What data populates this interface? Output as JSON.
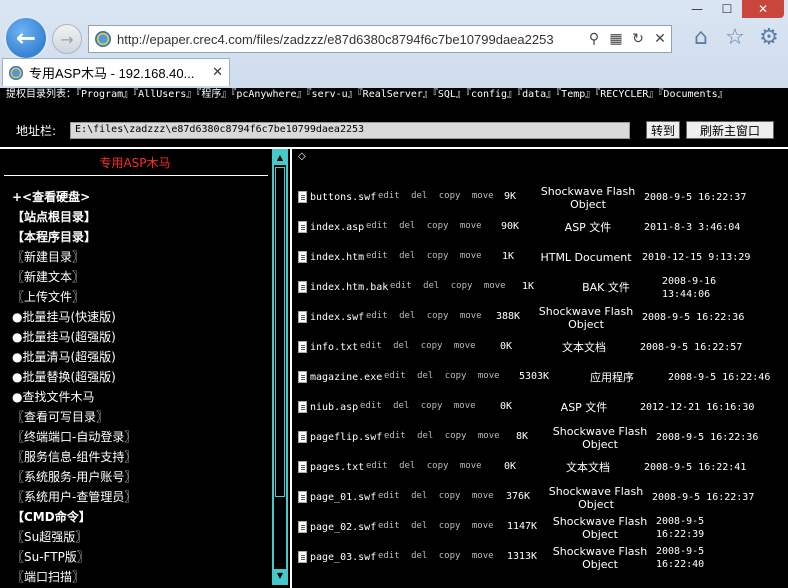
{
  "browser": {
    "window_buttons": {
      "minimize": "—",
      "maximize": "☐",
      "close": "✕"
    },
    "address_url": "http://epaper.crec4.com/files/zadzzz/e87d6380c8794f6c7be10799daea2253",
    "tab_title": "专用ASP木马 - 192.168.40...",
    "icons": [
      "back-icon",
      "forward-icon",
      "search-icon",
      "compat-icon",
      "refresh-icon",
      "stop-icon",
      "home-icon",
      "favorites-icon",
      "settings-icon"
    ]
  },
  "page": {
    "perm_label": "提权目录列表：",
    "perm_links": [
      "『Program』",
      "『AllUsers』",
      "『程序』",
      "『pcAnywhere』",
      "『serv-u』",
      "『RealServer』",
      "『SQL』",
      "『config』",
      "『data』",
      "『Temp』",
      "『RECYCLER』",
      "『Documents』"
    ],
    "addr_label": "地址栏:",
    "path_value": "E:\\files\\zadzzz\\e87d6380c8794f6c7be10799daea2253",
    "goto_label": "转到",
    "refresh_label": "刷新主窗口",
    "shell_title": "专用ASP木马",
    "right_anchor": "◇",
    "menu": [
      {
        "label": "+<查看硬盘>",
        "bold": true
      },
      {
        "label": "【站点根目录】",
        "bold": true
      },
      {
        "label": "【本程序目录】",
        "bold": true
      },
      {
        "label": "〖新建目录〗",
        "bold": false
      },
      {
        "label": "〖新建文本〗",
        "bold": false
      },
      {
        "label": "〖上传文件〗",
        "bold": false
      },
      {
        "label": "●批量挂马(快速版)",
        "bold": false
      },
      {
        "label": "●批量挂马(超强版)",
        "bold": false
      },
      {
        "label": "●批量清马(超强版)",
        "bold": false
      },
      {
        "label": "●批量替换(超强版)",
        "bold": false
      },
      {
        "label": "●查找文件木马",
        "bold": false
      },
      {
        "label": "〖查看可写目录〗",
        "bold": false
      },
      {
        "label": "〖终端端口-自动登录〗",
        "bold": false
      },
      {
        "label": "〖服务信息-组件支持〗",
        "bold": false
      },
      {
        "label": "〖系统服务-用户账号〗",
        "bold": false
      },
      {
        "label": "〖系统用户-查管理员〗",
        "bold": false
      },
      {
        "label": "【CMD命令】",
        "bold": true
      },
      {
        "label": "〖Su超强版〗",
        "bold": false
      },
      {
        "label": "〖Su-FTP版〗",
        "bold": false
      },
      {
        "label": "〖端口扫描〗",
        "bold": false
      }
    ],
    "files": [
      {
        "name": "buttons.swf",
        "actions": "edit del copy move",
        "size": "9K",
        "type": [
          "Shockwave Flash",
          "Object"
        ],
        "time": [
          "2008-9-5 16:22:37"
        ]
      },
      {
        "name": "index.asp",
        "actions": "edit del copy move",
        "size": "90K",
        "type": [
          "ASP 文件"
        ],
        "time": [
          "2011-8-3 3:46:04"
        ]
      },
      {
        "name": "index.htm",
        "actions": "edit del copy move",
        "size": "1K",
        "type": [
          "HTML Document"
        ],
        "time": [
          "2010-12-15 9:13:29"
        ]
      },
      {
        "name": "index.htm.bak",
        "actions": "edit del copy move",
        "size": "1K",
        "type": [
          "BAK 文件"
        ],
        "time": [
          "2008-9-16",
          "13:44:06"
        ]
      },
      {
        "name": "index.swf",
        "actions": "edit del copy move",
        "size": "388K",
        "type": [
          "Shockwave Flash",
          "Object"
        ],
        "time": [
          "2008-9-5 16:22:36"
        ]
      },
      {
        "name": "info.txt",
        "actions": "edit del copy move",
        "size": "0K",
        "type": [
          "文本文档"
        ],
        "time": [
          "2008-9-5 16:22:57"
        ]
      },
      {
        "name": "magazine.exe",
        "actions": "edit del copy move",
        "size": "5303K",
        "type": [
          "应用程序"
        ],
        "time": [
          "2008-9-5 16:22:46"
        ]
      },
      {
        "name": "niub.asp",
        "actions": "edit del copy move",
        "size": "0K",
        "type": [
          "ASP 文件"
        ],
        "time": [
          "2012-12-21 16:16:30"
        ]
      },
      {
        "name": "pageflip.swf",
        "actions": "edit del copy move",
        "size": "8K",
        "type": [
          "Shockwave Flash",
          "Object"
        ],
        "time": [
          "2008-9-5 16:22:36"
        ]
      },
      {
        "name": "pages.txt",
        "actions": "edit del copy move",
        "size": "0K",
        "type": [
          "文本文档"
        ],
        "time": [
          "2008-9-5 16:22:41"
        ]
      },
      {
        "name": "page_01.swf",
        "actions": "edit del copy move",
        "size": "376K",
        "type": [
          "Shockwave Flash",
          "Object"
        ],
        "time": [
          "2008-9-5 16:22:37"
        ]
      },
      {
        "name": "page_02.swf",
        "actions": "edit del copy move",
        "size": "1147K",
        "type": [
          "Shockwave Flash",
          "Object"
        ],
        "time": [
          "2008-9-5",
          "16:22:39"
        ]
      },
      {
        "name": "page_03.swf",
        "actions": "edit del copy move",
        "size": "1313K",
        "type": [
          "Shockwave Flash",
          "Object"
        ],
        "time": [
          "2008-9-5",
          "16:22:40"
        ]
      }
    ],
    "colors": {
      "background": "#000000",
      "title_red": "#ff2a2a",
      "scrollbar_teal": "#45c8c8"
    }
  }
}
